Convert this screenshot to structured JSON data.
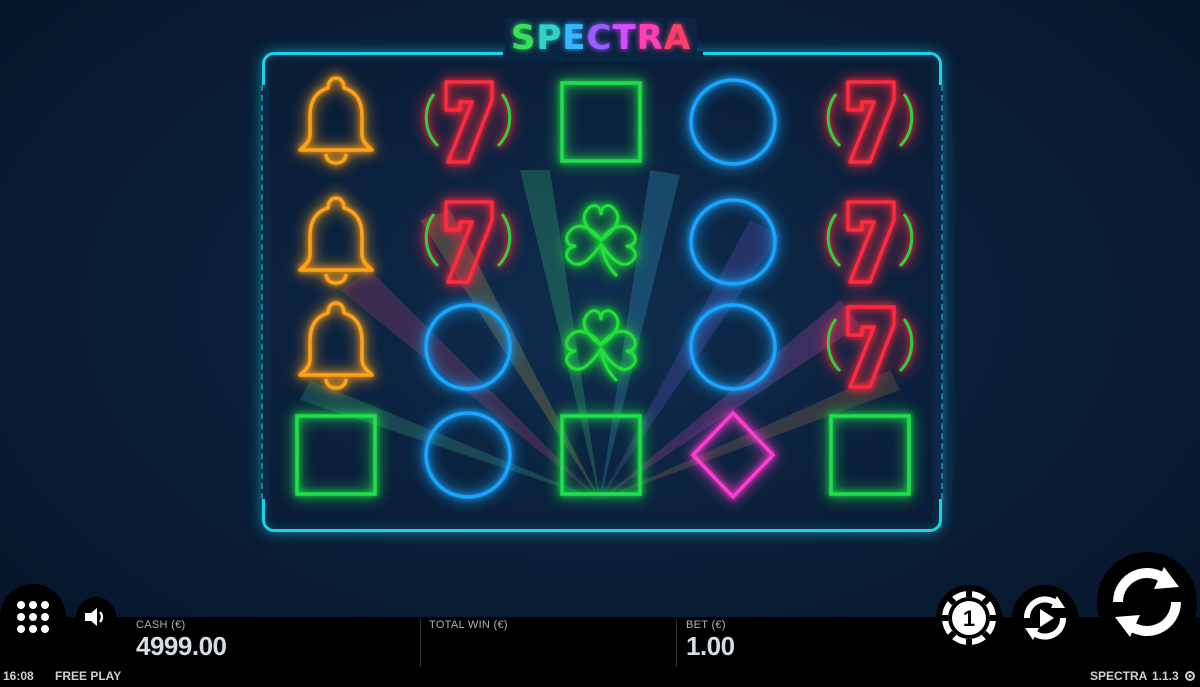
{
  "logo": {
    "text": "SPECTRA",
    "letters": [
      {
        "ch": "S",
        "color": "#37e05a"
      },
      {
        "ch": "P",
        "color": "#2fd4c8"
      },
      {
        "ch": "E",
        "color": "#34b8ff"
      },
      {
        "ch": "C",
        "color": "#9b5cff"
      },
      {
        "ch": "T",
        "color": "#d84dff"
      },
      {
        "ch": "R",
        "color": "#ff3fb2"
      },
      {
        "ch": "A",
        "color": "#ff3f6a"
      }
    ]
  },
  "reels": [
    [
      "bell",
      "bell",
      "bell",
      "square"
    ],
    [
      "seven",
      "seven",
      "circle",
      "circle"
    ],
    [
      "square",
      "clover",
      "clover",
      "square"
    ],
    [
      "circle",
      "circle",
      "circle",
      "diamond"
    ],
    [
      "seven",
      "seven",
      "seven",
      "square"
    ]
  ],
  "symbol_colors": {
    "bell": "#ffa21a",
    "seven": "#ff2a3d",
    "seven_ring": "#28d33c",
    "square": "#1fe04a",
    "circle": "#1aa6ff",
    "clover": "#22e03a",
    "diamond": "#ff3ccf"
  },
  "bottom_bar": {
    "cash_label": "CASH (€)",
    "cash_value": "4999.00",
    "total_win_label": "TOTAL WIN (€)",
    "total_win_value": "",
    "bet_label": "BET (€)",
    "bet_value": "1.00",
    "clock": "16:08",
    "mode": "FREE PLAY",
    "game_name": "SPECTRA",
    "version": "1.1.3"
  },
  "controls": {
    "menu_icon": "grid-dots-icon",
    "sound_icon": "speaker-icon",
    "coin_value": "1",
    "coin_icon": "chip-icon",
    "autoplay_icon": "autoplay-icon",
    "spin_icon": "spin-arrows-icon"
  }
}
